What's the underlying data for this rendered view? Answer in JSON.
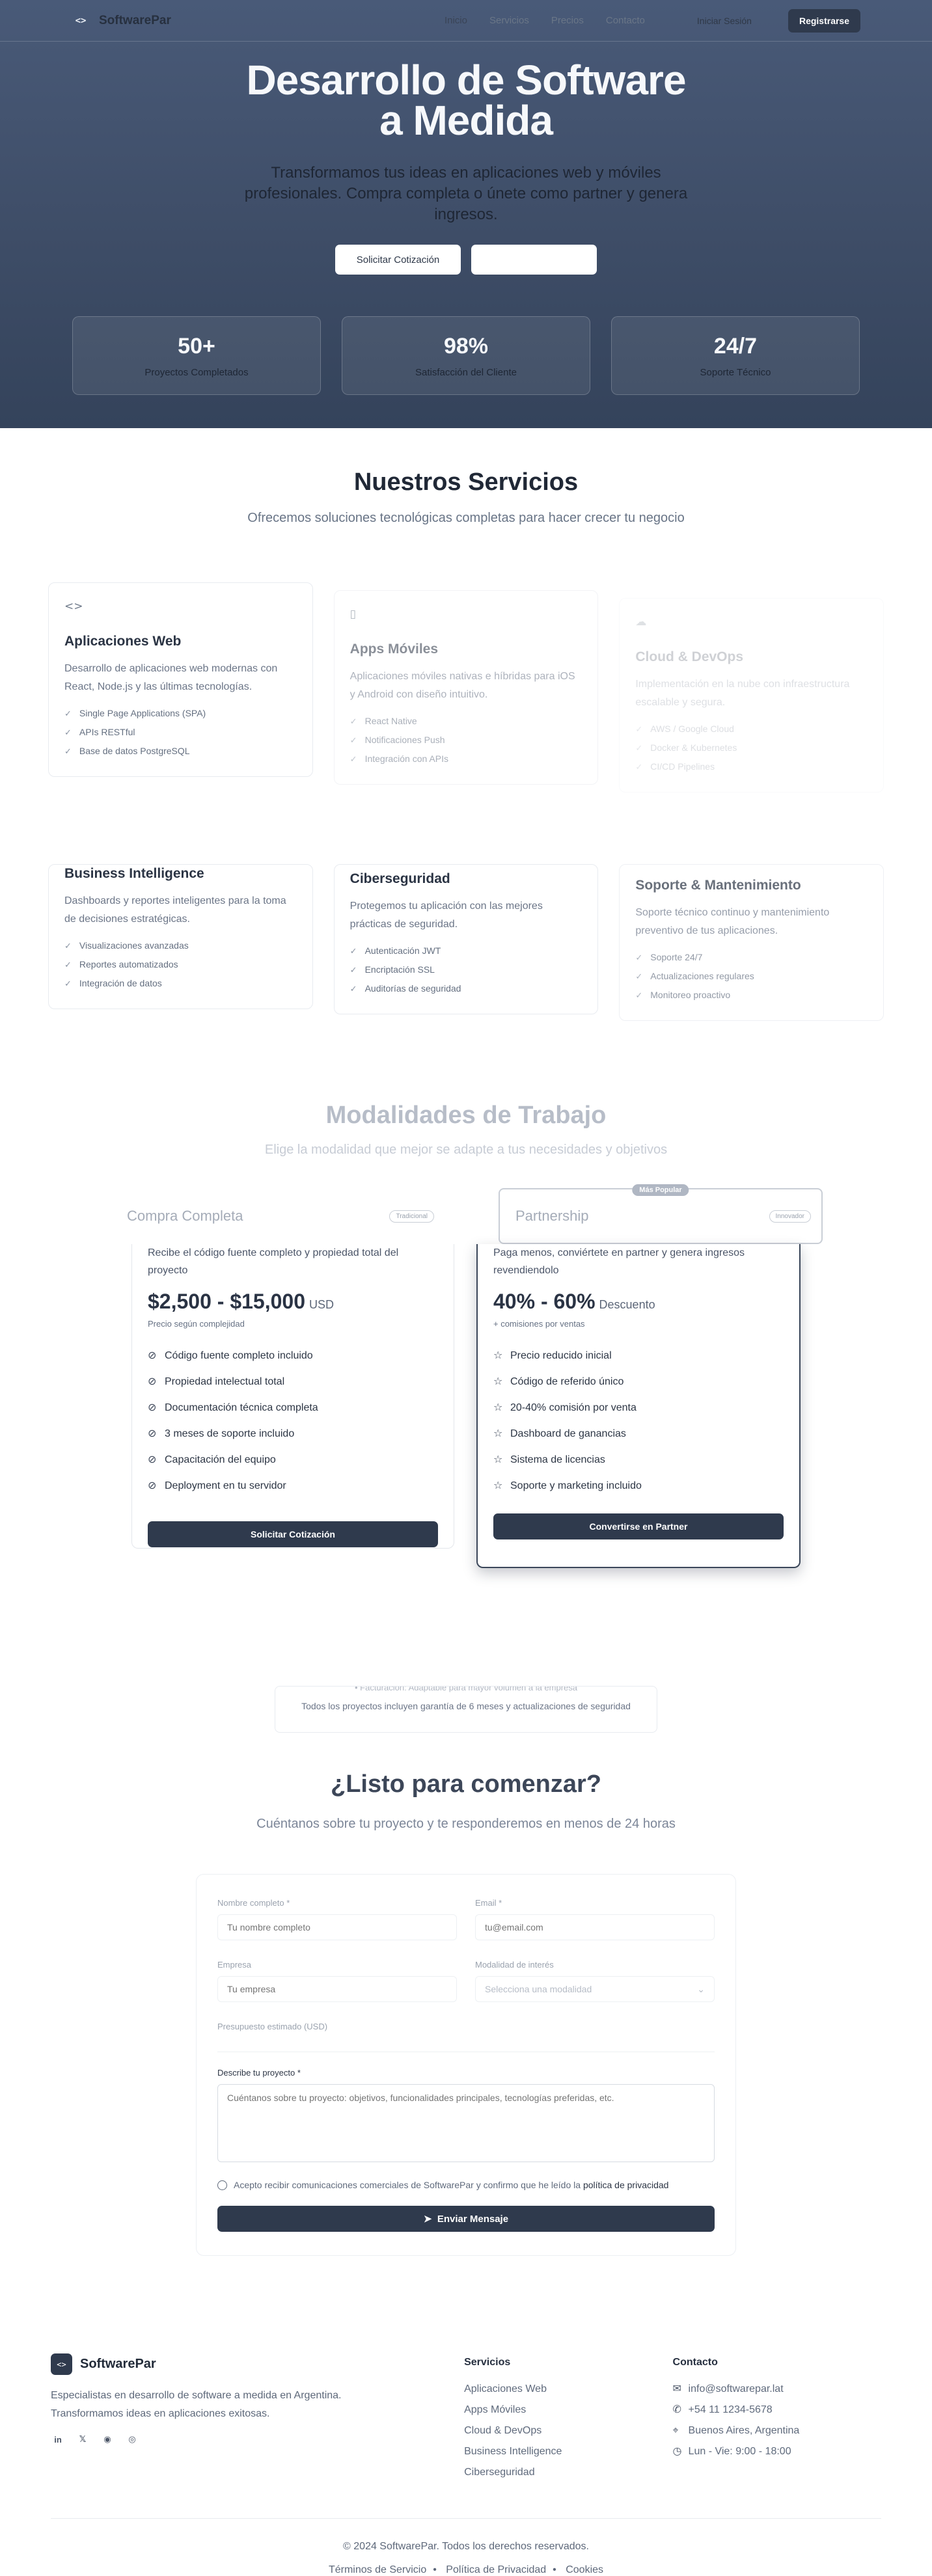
{
  "header": {
    "brand": "SoftwarePar",
    "brand_icon": "code-icon",
    "nav": [
      "Inicio",
      "Servicios",
      "Precios",
      "Contacto"
    ],
    "login": "Iniciar Sesión",
    "register": "Registrarse"
  },
  "hero": {
    "title_line1": "Desarrollo de Software",
    "title_line2": "a Medida",
    "subtitle": "Transformamos tus ideas en aplicaciones web y móviles profesionales. Compra completa o únete como partner y genera ingresos.",
    "cta_primary": "Solicitar Cotización",
    "cta_secondary": "",
    "stats": [
      {
        "value": "50+",
        "label": "Proyectos Completados"
      },
      {
        "value": "98%",
        "label": "Satisfacción del Cliente"
      },
      {
        "value": "24/7",
        "label": "Soporte Técnico"
      }
    ]
  },
  "services": {
    "title": "Nuestros Servicios",
    "subtitle": "Ofrecemos soluciones tecnológicas completas para hacer crecer tu negocio",
    "cards": [
      {
        "icon": "code-icon",
        "title": "Aplicaciones Web",
        "desc": "Desarrollo de aplicaciones web modernas con React, Node.js y las últimas tecnologías.",
        "features": [
          "Single Page Applications (SPA)",
          "APIs RESTful",
          "Base de datos PostgreSQL"
        ]
      },
      {
        "icon": "smartphone-icon",
        "title": "Apps Móviles",
        "desc": "Aplicaciones móviles nativas e híbridas para iOS y Android con diseño intuitivo.",
        "features": [
          "React Native",
          "Notificaciones Push",
          "Integración con APIs"
        ]
      },
      {
        "icon": "cloud-icon",
        "title": "Cloud & DevOps",
        "desc": "Implementación en la nube con infraestructura escalable y segura.",
        "features": [
          "AWS / Google Cloud",
          "Docker & Kubernetes",
          "CI/CD Pipelines"
        ]
      },
      {
        "icon": "chart-icon",
        "title": "Business Intelligence",
        "desc": "Dashboards y reportes inteligentes para la toma de decisiones estratégicas.",
        "features": [
          "Visualizaciones avanzadas",
          "Reportes automatizados",
          "Integración de datos"
        ]
      },
      {
        "icon": "shield-icon",
        "title": "Ciberseguridad",
        "desc": "Protegemos tu aplicación con las mejores prácticas de seguridad.",
        "features": [
          "Autenticación JWT",
          "Encriptación SSL",
          "Auditorías de seguridad"
        ]
      },
      {
        "icon": "wrench-icon",
        "title": "Soporte & Mantenimiento",
        "desc": "Soporte técnico continuo y mantenimiento preventivo de tus aplicaciones.",
        "features": [
          "Soporte 24/7",
          "Actualizaciones regulares",
          "Monitoreo proactivo"
        ]
      }
    ]
  },
  "plans": {
    "title": "Modalidades de Trabajo",
    "subtitle": "Elige la modalidad que mejor se adapte a tus necesidades y objetivos",
    "complete": {
      "title": "Compra Completa",
      "badge": "Tradicional",
      "desc": "Recibe el código fuente completo y propiedad total del proyecto",
      "price": "$2,500 - $15,000",
      "currency": "USD",
      "price_note": "Precio según complejidad",
      "features": [
        "Código fuente completo incluido",
        "Propiedad intelectual total",
        "Documentación técnica completa",
        "3 meses de soporte incluido",
        "Capacitación del equipo",
        "Deployment en tu servidor"
      ],
      "cta": "Solicitar Cotización"
    },
    "partner": {
      "title": "Partnership",
      "badge": "Innovador",
      "popular": "Más Popular",
      "desc": "Paga menos, conviértete en partner y genera ingresos revendiendolo",
      "price": "40% - 60%",
      "unit": "Descuento",
      "price_note": "+ comisiones por ventas",
      "features": [
        "Precio reducido inicial",
        "Código de referido único",
        "20-40% comisión por venta",
        "Dashboard de ganancias",
        "Sistema de licencias",
        "Soporte y marketing incluido"
      ],
      "cta": "Convertirse en Partner"
    },
    "note_clipped": "• Facturación: Adaptable para mayor volumen a la empresa",
    "note": "Todos los proyectos incluyen garantía de 6 meses y actualizaciones de seguridad"
  },
  "contact": {
    "title": "¿Listo para comenzar?",
    "subtitle": "Cuéntanos sobre tu proyecto y te responderemos en menos de 24 horas",
    "name_label": "Nombre completo *",
    "name_ph": "Tu nombre completo",
    "email_label": "Email *",
    "email_ph": "tu@email.com",
    "company_label": "Empresa",
    "company_ph": "Tu empresa",
    "mode_label": "Modalidad de interés",
    "mode_ph": "Selecciona una modalidad",
    "budget_label": "Presupuesto estimado (USD)",
    "project_label": "Describe tu proyecto *",
    "project_ph": "Cuéntanos sobre tu proyecto: objetivos, funcionalidades principales, tecnologías preferidas, etc.",
    "consent_text": "Acepto recibir comunicaciones comerciales de SoftwarePar y confirmo que he leído la",
    "consent_link": "política de privacidad",
    "send": "Enviar Mensaje"
  },
  "footer": {
    "brand": "SoftwarePar",
    "desc": "Especialistas en desarrollo de software a medida en Argentina. Transformamos ideas en aplicaciones exitosas.",
    "social": [
      "linkedin-icon",
      "twitter-icon",
      "github-icon",
      "instagram-icon"
    ],
    "services_title": "Servicios",
    "services": [
      "Aplicaciones Web",
      "Apps Móviles",
      "Cloud & DevOps",
      "Business Intelligence",
      "Ciberseguridad"
    ],
    "contact_title": "Contacto",
    "contact": [
      {
        "icon": "mail-icon",
        "text": "info@softwarepar.lat"
      },
      {
        "icon": "phone-icon",
        "text": "+54 11 1234-5678"
      },
      {
        "icon": "location-icon",
        "text": "Buenos Aires, Argentina"
      },
      {
        "icon": "clock-icon",
        "text": "Lun - Vie: 9:00 - 18:00"
      }
    ],
    "copyright": "© 2024 SoftwarePar. Todos los derechos reservados.",
    "terms": "Términos de Servicio",
    "privacy": "Política de Privacidad",
    "cookies": "Cookies"
  }
}
